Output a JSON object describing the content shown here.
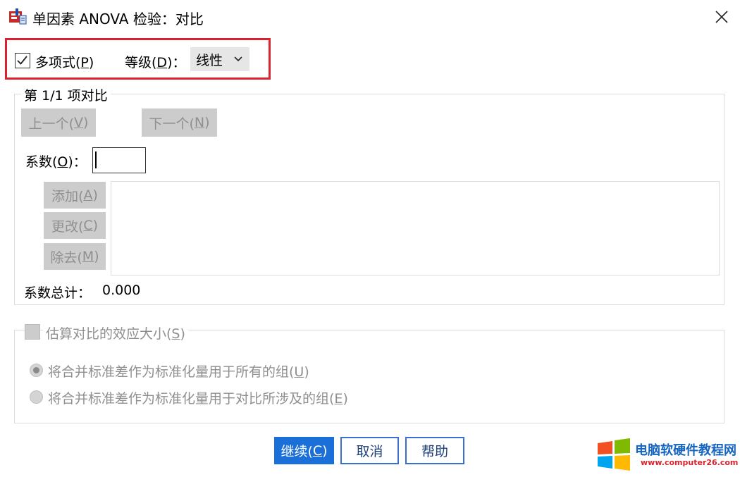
{
  "window": {
    "title": "单因素 ANOVA 检验：对比",
    "close_icon": "close-icon",
    "app_icon": "spss-app-icon"
  },
  "polynomial": {
    "checked": true,
    "label_main": "多项式(",
    "label_key": "P",
    "label_end": ")",
    "degree_label_main": "等级(",
    "degree_label_key": "D",
    "degree_label_end": ")：",
    "degree_value": "线性"
  },
  "contrast_group": {
    "title": "第 1/1 项对比",
    "prev_main": "上一个(",
    "prev_key": "V",
    "prev_end": ")",
    "next_main": "下一个(",
    "next_key": "N",
    "next_end": ")",
    "coef_label_main": "系数(",
    "coef_label_key": "O",
    "coef_label_end": ")：",
    "coef_value": "",
    "add_main": "添加(",
    "add_key": "A",
    "add_end": ")",
    "change_main": "更改(",
    "change_key": "C",
    "change_end": ")",
    "remove_main": "除去(",
    "remove_key": "M",
    "remove_end": ")",
    "total_label": "系数总计：",
    "total_value": "0.000"
  },
  "effect_group": {
    "checkbox_main": "估算对比的效应大小(",
    "checkbox_key": "S",
    "checkbox_end": ")",
    "checked": false,
    "radio1_main": "将合并标准差作为标准化量用于所有的组(",
    "radio1_key": "U",
    "radio1_end": ")",
    "radio1_selected": true,
    "radio2_main": "将合并标准差作为标准化量用于对比所涉及的组(",
    "radio2_key": "E",
    "radio2_end": ")",
    "radio2_selected": false
  },
  "footer": {
    "continue_main": "继续(",
    "continue_key": "C",
    "continue_end": ")",
    "cancel_label": "取消",
    "help_label": "帮助"
  },
  "watermark": {
    "title": "电脑软硬件教程网",
    "url": "www.computer26.com"
  },
  "colors": {
    "highlight": "#d9232e",
    "primary_button": "#1a6fd9",
    "disabled_button": "#cccccc",
    "disabled_text": "#8f8f8f"
  }
}
